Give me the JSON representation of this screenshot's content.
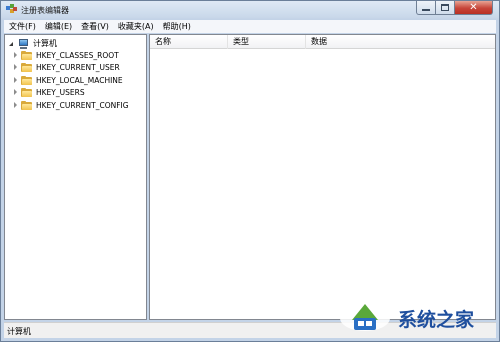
{
  "window": {
    "title": "注册表编辑器"
  },
  "menu": {
    "items": [
      {
        "label": "文件(F)"
      },
      {
        "label": "编辑(E)"
      },
      {
        "label": "查看(V)"
      },
      {
        "label": "收藏夹(A)"
      },
      {
        "label": "帮助(H)"
      }
    ]
  },
  "tree": {
    "root": {
      "label": "计算机",
      "icon": "computer-icon",
      "expanded": true
    },
    "items": [
      {
        "label": "HKEY_CLASSES_ROOT",
        "icon": "folder-icon"
      },
      {
        "label": "HKEY_CURRENT_USER",
        "icon": "folder-icon"
      },
      {
        "label": "HKEY_LOCAL_MACHINE",
        "icon": "folder-icon"
      },
      {
        "label": "HKEY_USERS",
        "icon": "folder-icon"
      },
      {
        "label": "HKEY_CURRENT_CONFIG",
        "icon": "folder-icon"
      }
    ]
  },
  "list": {
    "columns": [
      "名称",
      "类型",
      "数据"
    ]
  },
  "status": {
    "path": "计算机"
  },
  "watermark": {
    "text": "系统之家"
  },
  "colors": {
    "close_button": "#c7453a",
    "folder": "#f1c24d",
    "watermark": "#1f4f9e"
  }
}
